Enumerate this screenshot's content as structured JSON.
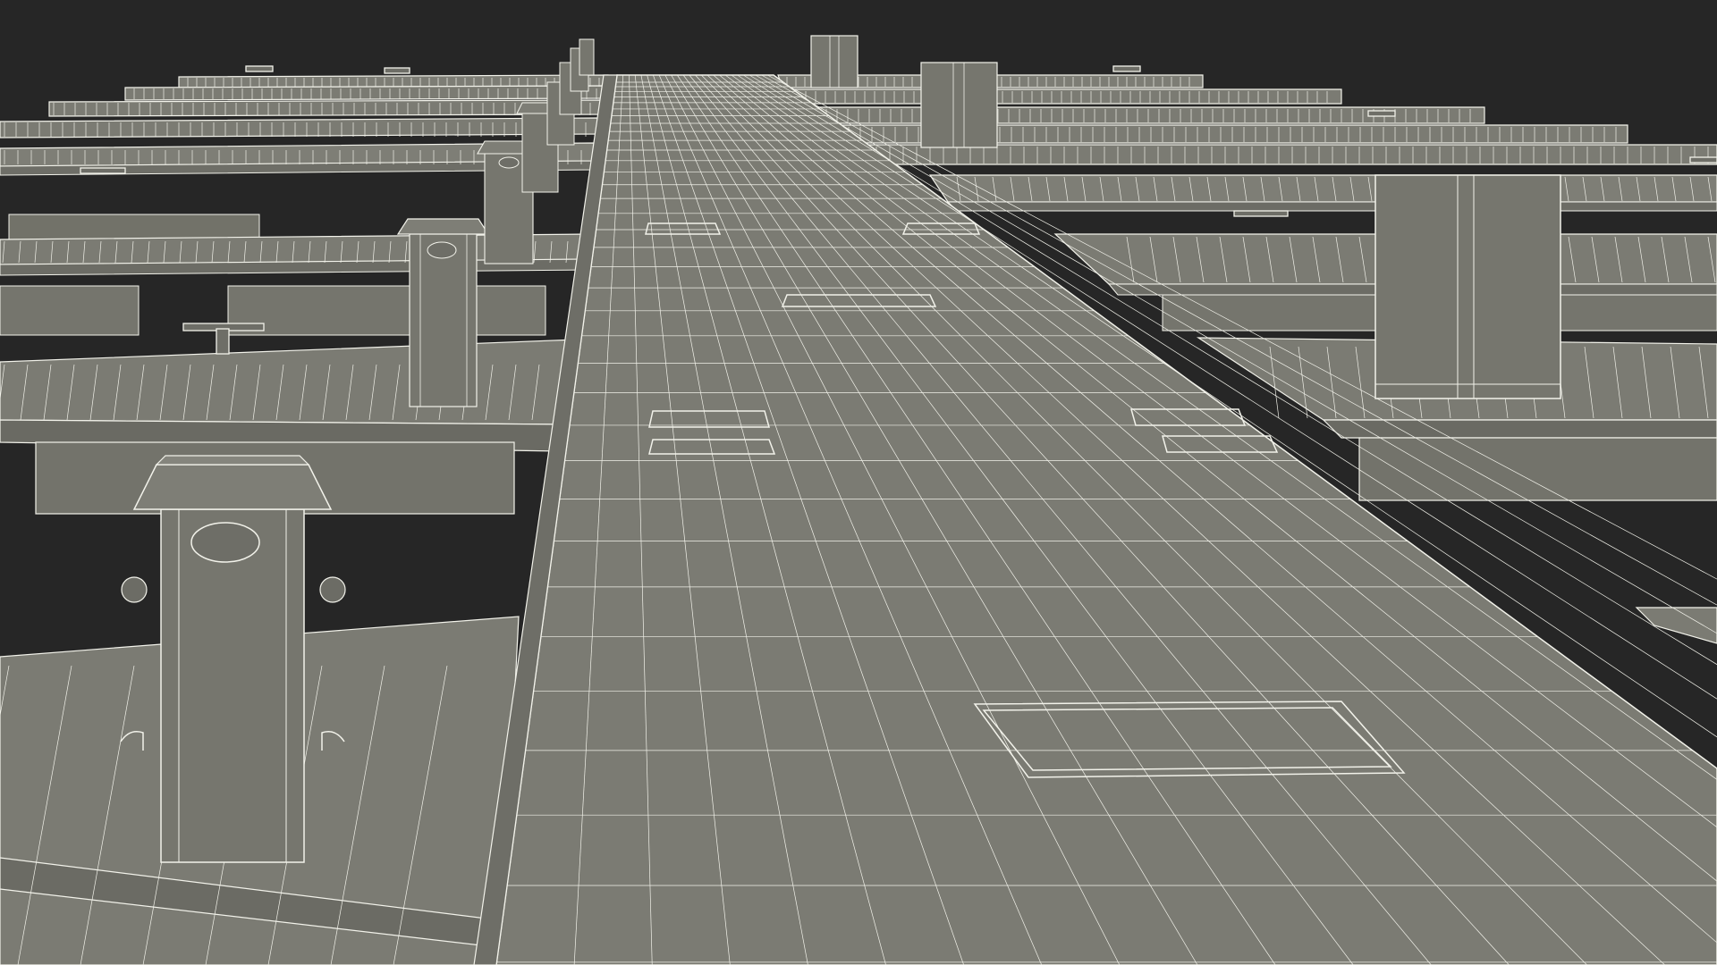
{
  "scene": {
    "subject": "",
    "colors": {
      "background": "#262626",
      "surface": "#7b7b73",
      "surface_light": "#8a8a82",
      "surface_dark": "#66665f",
      "wire": "#f2f2ea"
    }
  }
}
